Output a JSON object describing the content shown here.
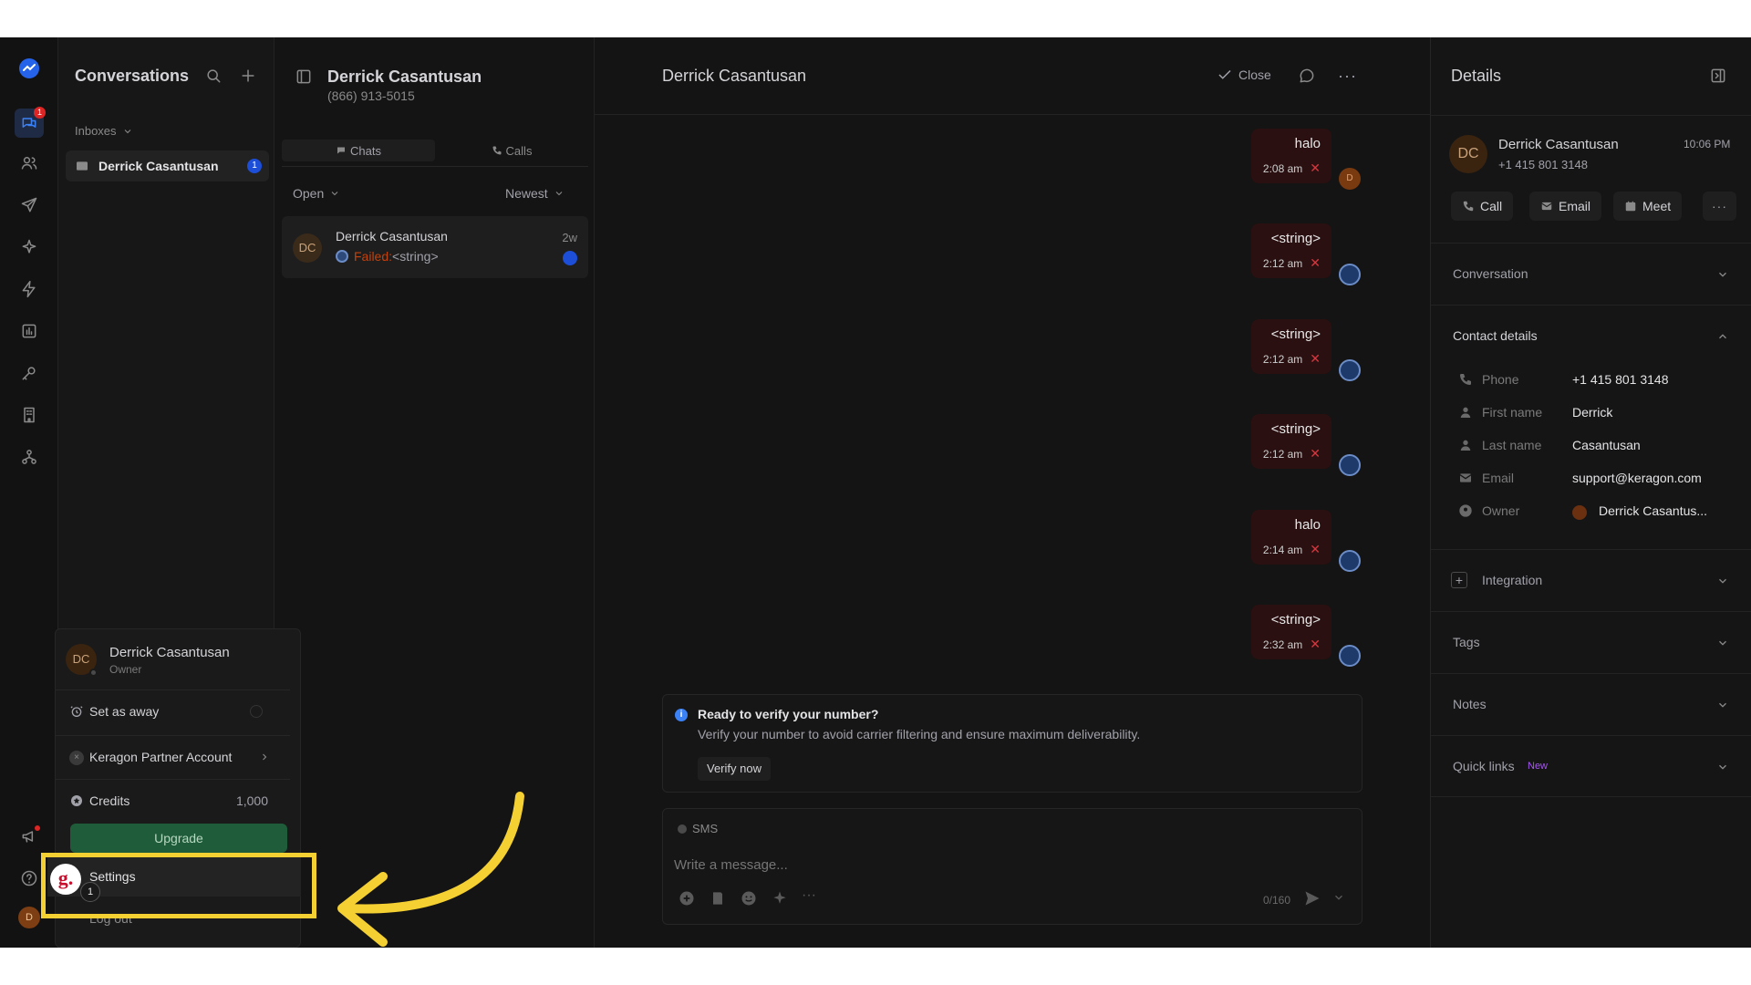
{
  "sidebar_rail": {
    "icons": [
      "logo-icon",
      "chat-icon",
      "contacts-icon",
      "send-icon",
      "sparkle-icon",
      "bolt-icon",
      "chart-icon",
      "key-icon",
      "building-icon",
      "network-icon",
      "megaphone-icon",
      "help-icon"
    ],
    "chat_badge": "1",
    "avatar_initial": "D"
  },
  "conversations": {
    "title": "Conversations",
    "inboxes_label": "Inboxes",
    "inbox_item": {
      "name": "Derrick Casantusan",
      "count": "1"
    }
  },
  "user_menu": {
    "avatar_initials": "DC",
    "name": "Derrick Casantusan",
    "role": "Owner",
    "set_away": "Set as away",
    "partner": "Keragon Partner Account",
    "credits_label": "Credits",
    "credits_value": "1,000",
    "upgrade": "Upgrade",
    "settings": "Settings",
    "logout": "Log out",
    "step_badge": "1",
    "logo_letter": "g."
  },
  "list": {
    "contact_name": "Derrick Casantusan",
    "contact_phone": "(866) 913-5015",
    "tabs": [
      "Chats",
      "Calls"
    ],
    "filter_status": "Open",
    "sort": "Newest",
    "item": {
      "initials": "DC",
      "name": "Derrick Casantusan",
      "status": "Failed:",
      "preview": "<string>",
      "time": "2w"
    }
  },
  "chat": {
    "header_name": "Derrick Casantusan",
    "close_label": "Close",
    "messages": [
      {
        "text": "halo",
        "time": "2:08 am",
        "avatar": "D"
      },
      {
        "text": "<string>",
        "time": "2:12 am"
      },
      {
        "text": "<string>",
        "time": "2:12 am"
      },
      {
        "text": "<string>",
        "time": "2:12 am"
      },
      {
        "text": "halo",
        "time": "2:14 am"
      },
      {
        "text": "<string>",
        "time": "2:32 am"
      }
    ],
    "verify": {
      "title": "Ready to verify your number?",
      "body": "Verify your number to avoid carrier filtering and ensure maximum deliverability.",
      "button": "Verify now"
    },
    "composer": {
      "channel": "SMS",
      "placeholder": "Write a message...",
      "counter": "0/160"
    }
  },
  "details": {
    "title": "Details",
    "contact": {
      "initials": "DC",
      "name": "Derrick Casantusan",
      "phone": "+1 415 801 3148",
      "time": "10:06 PM"
    },
    "actions": [
      "Call",
      "Email",
      "Meet"
    ],
    "sections": {
      "conversation": "Conversation",
      "contact_details": "Contact details",
      "integration": "Integration",
      "tags": "Tags",
      "notes": "Notes",
      "quick_links": "Quick links",
      "new_badge": "New"
    },
    "fields": [
      {
        "label": "Phone",
        "value": "+1 415 801 3148"
      },
      {
        "label": "First name",
        "value": "Derrick"
      },
      {
        "label": "Last name",
        "value": "Casantusan"
      },
      {
        "label": "Email",
        "value": "support@keragon.com"
      },
      {
        "label": "Owner",
        "value": "Derrick Casantus..."
      }
    ]
  },
  "colors": {
    "accent_blue": "#2563eb",
    "upgrade_green": "#1f5d3a",
    "error_red": "#d9363e",
    "highlight_yellow": "#f5d033",
    "bubble_bg": "#2a1010"
  }
}
